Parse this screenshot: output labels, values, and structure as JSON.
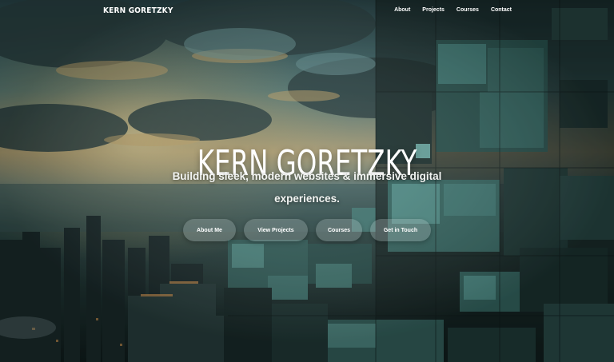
{
  "header": {
    "logo_text": "KERN GORETZKY",
    "nav": [
      {
        "label": "About"
      },
      {
        "label": "Projects"
      },
      {
        "label": "Courses"
      },
      {
        "label": "Contact"
      }
    ]
  },
  "hero": {
    "title": "KERN GORETZKY",
    "subtitle": "Building sleek, modern websites & immersive digital experiences.",
    "buttons": [
      {
        "label": "About Me"
      },
      {
        "label": "View Projects"
      },
      {
        "label": "Courses"
      },
      {
        "label": "Get in Touch"
      }
    ]
  },
  "colors": {
    "sky_teal": "#4f8f93",
    "sunset_gold": "#e8c77a",
    "city_dark": "#12201f",
    "tile_teal": "#3f7a74",
    "button_bg": "rgba(190,205,205,0.28)",
    "text": "#ffffff"
  }
}
